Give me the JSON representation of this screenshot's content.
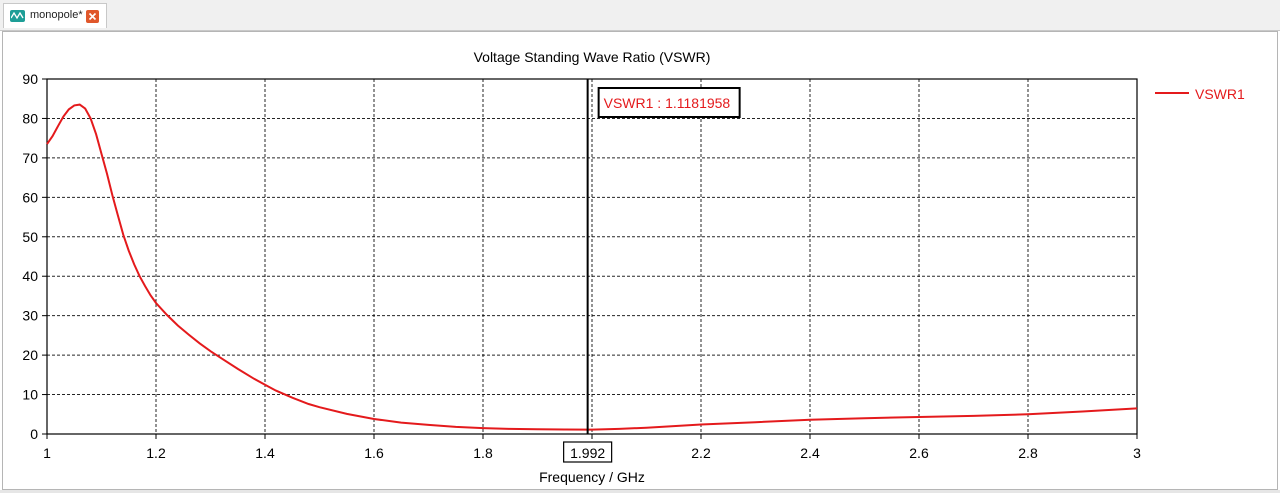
{
  "tab": {
    "title": "monopole*",
    "icon": "cst-project-icon",
    "close_icon": "close-icon"
  },
  "colors": {
    "curve": "#e41a1c",
    "marker_line": "#000000",
    "grid": "#000000"
  },
  "chart_data": {
    "type": "line",
    "title": "Voltage Standing Wave Ratio (VSWR)",
    "xlabel": "Frequency / GHz",
    "ylabel": "",
    "xlim": [
      1,
      3
    ],
    "ylim": [
      0,
      90
    ],
    "xticks": [
      "1",
      "1.2",
      "1.4",
      "1.6",
      "1.8",
      "2",
      "2.2",
      "2.4",
      "2.6",
      "2.8",
      "3"
    ],
    "yticks": [
      "0",
      "10",
      "20",
      "30",
      "40",
      "50",
      "60",
      "70",
      "80",
      "90"
    ],
    "grid": true,
    "legend_position": "right",
    "series": [
      {
        "name": "VSWR1",
        "x": [
          1.0,
          1.01,
          1.02,
          1.03,
          1.04,
          1.05,
          1.06,
          1.07,
          1.08,
          1.09,
          1.1,
          1.11,
          1.12,
          1.13,
          1.14,
          1.15,
          1.16,
          1.17,
          1.18,
          1.19,
          1.2,
          1.22,
          1.24,
          1.26,
          1.28,
          1.3,
          1.32,
          1.35,
          1.38,
          1.4,
          1.42,
          1.45,
          1.48,
          1.5,
          1.55,
          1.6,
          1.65,
          1.7,
          1.75,
          1.8,
          1.85,
          1.9,
          1.95,
          1.992,
          2.0,
          2.05,
          2.1,
          2.15,
          2.2,
          2.3,
          2.4,
          2.5,
          2.6,
          2.7,
          2.8,
          2.9,
          3.0
        ],
        "y": [
          73.5,
          75.5,
          78,
          80.5,
          82.3,
          83.3,
          83.5,
          82.5,
          80,
          76,
          71,
          66,
          60.5,
          55.5,
          50.5,
          46.5,
          43,
          40,
          37.5,
          35.2,
          33.2,
          30.2,
          27.5,
          25.2,
          23,
          21,
          19.2,
          16.5,
          14,
          12.5,
          11,
          9.2,
          7.6,
          6.8,
          5.1,
          3.8,
          2.9,
          2.3,
          1.8,
          1.5,
          1.3,
          1.2,
          1.14,
          1.1181958,
          1.12,
          1.3,
          1.6,
          2.0,
          2.4,
          3.0,
          3.6,
          4.0,
          4.3,
          4.6,
          5.0,
          5.7,
          6.5
        ]
      }
    ],
    "marker": {
      "x": 1.992,
      "x_label": "1.992",
      "readout": "VSWR1 : 1.1181958"
    }
  }
}
